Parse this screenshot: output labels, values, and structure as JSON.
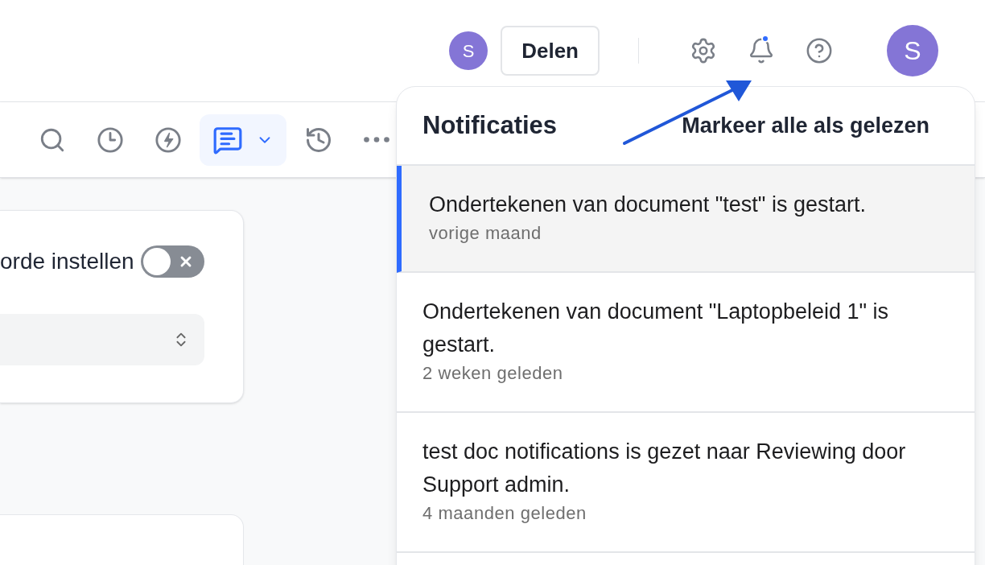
{
  "header": {
    "collaborator_avatar": "S",
    "share_button": "Delen",
    "notifications_unread": true,
    "user_avatar": "S"
  },
  "toolbar": {
    "buttons": [
      {
        "kind": "search",
        "selected": false
      },
      {
        "kind": "clock",
        "selected": false
      },
      {
        "kind": "lightning",
        "selected": false
      },
      {
        "kind": "comments",
        "selected": true
      },
      {
        "kind": "history",
        "selected": false
      },
      {
        "kind": "more",
        "selected": false
      }
    ]
  },
  "form": {
    "toggle_label": "orde instellen",
    "toggle_on": false
  },
  "notifications": {
    "title": "Notificaties",
    "mark_all_read": "Markeer alle als gelezen",
    "items": [
      {
        "text": "Ondertekenen van document \"test\" is gestart.",
        "time": "vorige maand",
        "selected": true
      },
      {
        "text": "Ondertekenen van document \"Laptopbeleid 1\" is gestart.",
        "time": "2 weken geleden",
        "selected": false
      },
      {
        "text": "test doc notifications is gezet naar Reviewing door Support admin.",
        "time": "4 maanden geleden",
        "selected": false
      }
    ]
  }
}
